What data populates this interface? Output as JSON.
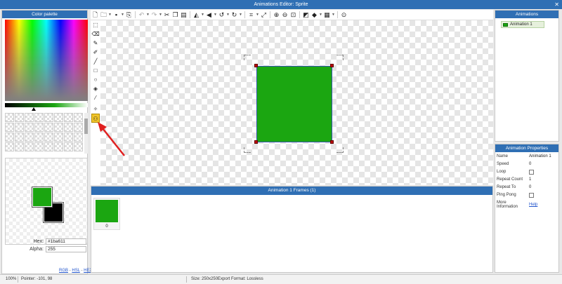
{
  "window": {
    "title": "Animations Editor: Sprite",
    "close_glyph": "✕"
  },
  "palette": {
    "title": "Color palette",
    "hex_label": "Hex:",
    "hex_value": "#1ba611",
    "alpha_label": "Alpha:",
    "alpha_value": "255",
    "link_rgb": "RGB",
    "link_hsl": "HSL",
    "link_hex": "HEX",
    "link_sep": " - ",
    "primary_color": "#1ba611",
    "secondary_color": "#000000"
  },
  "toolbar": {
    "new": "new-file-icon",
    "open": "open-folder-icon",
    "save": "save-icon",
    "export": "export-icon",
    "undo": "undo-icon",
    "redo": "redo-icon",
    "cut": "cut-icon",
    "copy": "copy-icon",
    "paste": "paste-icon",
    "flip_h": "flip-horizontal-icon",
    "flip_v": "flip-vertical-icon",
    "rotate_left": "rotate-left-icon",
    "rotate_right": "rotate-right-icon",
    "crop": "crop-icon",
    "resize": "resize-icon",
    "zoom_in": "zoom-in-icon",
    "zoom_out": "zoom-out-icon",
    "zoom_fit": "zoom-fit-icon",
    "fill_mode": "fill-mode-icon",
    "layers": "layers-icon",
    "grid": "grid-icon",
    "play": "play-icon"
  },
  "tools": [
    "rect-select-icon",
    "eraser-icon",
    "pencil-icon",
    "brush-icon",
    "line-icon",
    "rectangle-icon",
    "ellipse-icon",
    "fill-bucket-icon",
    "eyedropper-icon",
    "magic-wand-icon",
    "skeleton-icon"
  ],
  "frames_panel": {
    "title": "Animation 1 Frames (1)",
    "frames": [
      {
        "index": "0",
        "color": "#1ba611"
      }
    ]
  },
  "animations_panel": {
    "title": "Animations",
    "items": [
      {
        "label": "Animation 1"
      }
    ]
  },
  "properties": {
    "title": "Animation Properties",
    "name_label": "Name",
    "name_value": "Animation 1",
    "speed_label": "Speed",
    "speed_value": "0",
    "loop_label": "Loop",
    "repeat_count_label": "Repeat Count",
    "repeat_count_value": "1",
    "repeat_to_label": "Repeat To",
    "repeat_to_value": "0",
    "ping_pong_label": "Ping Pong",
    "more_info_label_1": "More",
    "more_info_label_2": "Information",
    "help_link": "Help"
  },
  "status": {
    "zoom": "100%",
    "pointer": "Pointer: -101, 98",
    "size": "Size: 250x250",
    "export_format": "Export Format: Lossless"
  },
  "colors": {
    "accent": "#2f6fb4",
    "sprite": "#1ba611",
    "active_tool": "#f0c42a",
    "annotation_arrow": "#e02020"
  }
}
